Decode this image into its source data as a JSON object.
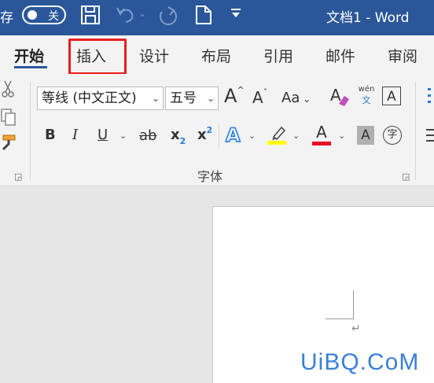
{
  "titlebar": {
    "autosave_label": "存",
    "autosave_state": "关",
    "doc_title": "文档1 - Word",
    "icons": [
      "save-icon",
      "undo-icon",
      "redo-icon",
      "new-document-icon",
      "customize-toolbar-icon"
    ]
  },
  "tabs": [
    "开始",
    "插入",
    "设计",
    "布局",
    "引用",
    "邮件",
    "审阅"
  ],
  "active_tab": "开始",
  "highlighted_tab": "插入",
  "ribbon": {
    "font_name": "等线 (中文正文)",
    "font_size": "五号",
    "grow_font": "A",
    "shrink_font": "A",
    "change_case": "Aa",
    "phonetic_top": "wén",
    "phonetic_bottom": "文",
    "char_border": "A",
    "bold": "B",
    "italic": "I",
    "underline": "U",
    "strike": "ab",
    "subscript_base": "x",
    "subscript_mark": "2",
    "superscript_base": "x",
    "superscript_mark": "2",
    "text_effects": "A",
    "font_color_letter": "A",
    "char_shading": "A",
    "enclose_char": "字",
    "group_label": "字体"
  },
  "colors": {
    "brand": "#2b579a",
    "highlight": "#ffff00",
    "font_color": "#e81123",
    "annotation": "#e81e1e"
  },
  "document": {
    "paragraph_mark": "↵"
  },
  "watermark": "UiBQ.CoM"
}
